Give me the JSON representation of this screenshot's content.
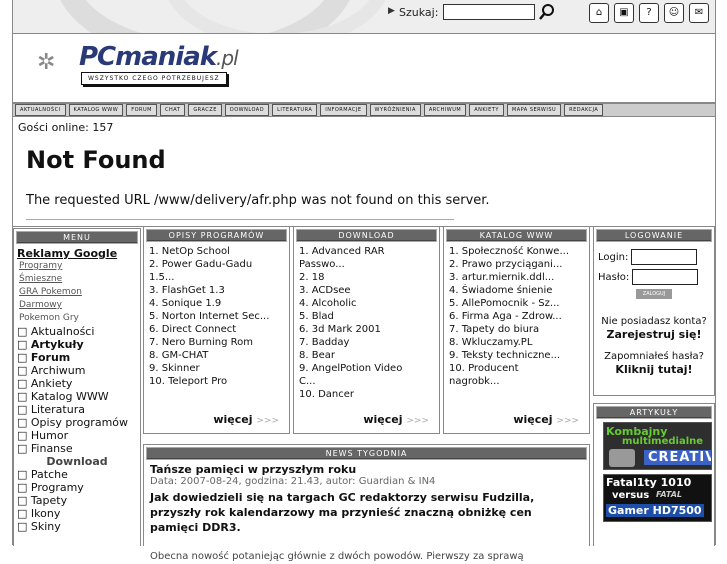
{
  "search": {
    "label": "Szukaj:",
    "placeholder": ""
  },
  "top_icons": [
    "home-icon",
    "page-icon",
    "help-icon",
    "users-icon",
    "mail-icon"
  ],
  "logo": {
    "brand": "PCmaniak",
    "tld": ".pl",
    "tagline": "WSZYSTKO CZEGO POTRZEBUJESZ"
  },
  "nav": [
    "AKTUALNOŚCI",
    "KATALOG WWW",
    "FORUM",
    "CHAT",
    "GRACZE",
    "DOWNLOAD",
    "LITERATURA",
    "INFORMACJE",
    "WYRÓŻNIENIA",
    "ARCHIWUM",
    "ANKIETY",
    "MAPA SERWISU",
    "REDAKCJA"
  ],
  "error": {
    "guests": "Gości online: 157",
    "title": "Not Found",
    "message": "The requested URL /www/delivery/afr.php was not found on this server."
  },
  "menu": {
    "title": "MENU",
    "ads_heading": "Reklamy Google",
    "ads": [
      "Programy",
      "Śmieszne",
      "GRA Pokemon",
      "Darmowy"
    ],
    "ads_plain": "Pokemon Gry",
    "items": [
      {
        "label": "Aktualności",
        "bold": false
      },
      {
        "label": "Artykuły",
        "bold": true
      },
      {
        "label": "Forum",
        "bold": true
      },
      {
        "label": "Archiwum",
        "bold": false
      },
      {
        "label": "Ankiety",
        "bold": false
      },
      {
        "label": "Katalog WWW",
        "bold": false
      },
      {
        "label": "Literatura",
        "bold": false
      },
      {
        "label": "Opisy programów",
        "bold": false
      },
      {
        "label": "Humor",
        "bold": false
      },
      {
        "label": "Finanse",
        "bold": false
      }
    ],
    "download_heading": "Download",
    "download_items": [
      "Patche",
      "Programy",
      "Tapety",
      "Ikony",
      "Skiny"
    ]
  },
  "opisy": {
    "title": "OPISY PROGRAMÓW",
    "items": [
      "1. NetOp School",
      "2. Power Gadu-Gadu",
      "1.5...",
      "3. FlashGet 1.3",
      "4. Sonique 1.9",
      "5. Norton Internet Sec...",
      "6. Direct Connect",
      "7. Nero Burning Rom",
      "8. GM-CHAT",
      "9. Skinner",
      "10. Teleport Pro"
    ],
    "more": "więcej"
  },
  "download": {
    "title": "DOWNLOAD",
    "items": [
      "1. Advanced RAR",
      "Passwo...",
      "2. 18",
      "3. ACDsee",
      "4. Alcoholic",
      "5. Blad",
      "6. 3d Mark 2001",
      "7. Badday",
      "8. Bear",
      "9. AngelPotion Video",
      "C...",
      "10. Dancer"
    ],
    "more": "więcej"
  },
  "katalog": {
    "title": "KATALOG WWW",
    "items": [
      "1. Społeczność Konwe...",
      "2. Prawo przyciągani...",
      "3. artur.miernik.ddl...",
      "4. Świadome śnienie",
      "5. AllePomocnik - Sz...",
      "6. Firma Aga - Zdrow...",
      "7. Tapety do biura",
      "8. Wkluczamy.PL",
      "9. Teksty techniczne...",
      "10. Producent",
      "nagrobk..."
    ],
    "more": "więcej"
  },
  "login": {
    "title": "LOGOWANIE",
    "login_label": "Login:",
    "password_label": "Hasło:",
    "button": "ZALOGUJ",
    "no_account": "Nie posiadasz konta?",
    "register": "Zarejestruj się!",
    "forgot": "Zapomniałeś hasła?",
    "click_here": "Kliknij tutaj!"
  },
  "artykuly": {
    "title": "ARTYKUŁY",
    "ad1": {
      "line1": "Kombajny",
      "line2": "multimedialne",
      "brand": "CREATIVE"
    },
    "ad2": {
      "line1": "Fatal1ty 1010",
      "line2": "versus",
      "line3": "Gamer HD7500",
      "fatal": "FATAL"
    }
  },
  "news": {
    "title": "NEWS TYGODNIA",
    "headline": "Tańsze pamięci w przyszłym roku",
    "meta": "Data: 2007-08-24, godzina: 21.43, autor: Guardian & IN4",
    "lead": "Jak dowiedzieli się na targach GC redaktorzy serwisu Fudzilla, przyszły rok kalendarzowy ma przynieść znaczną obniżkę cen pamięci DDR3.",
    "text": "Obecna nowość potaniejąc głównie z dwóch powodów. Pierwszy za sprawą"
  }
}
